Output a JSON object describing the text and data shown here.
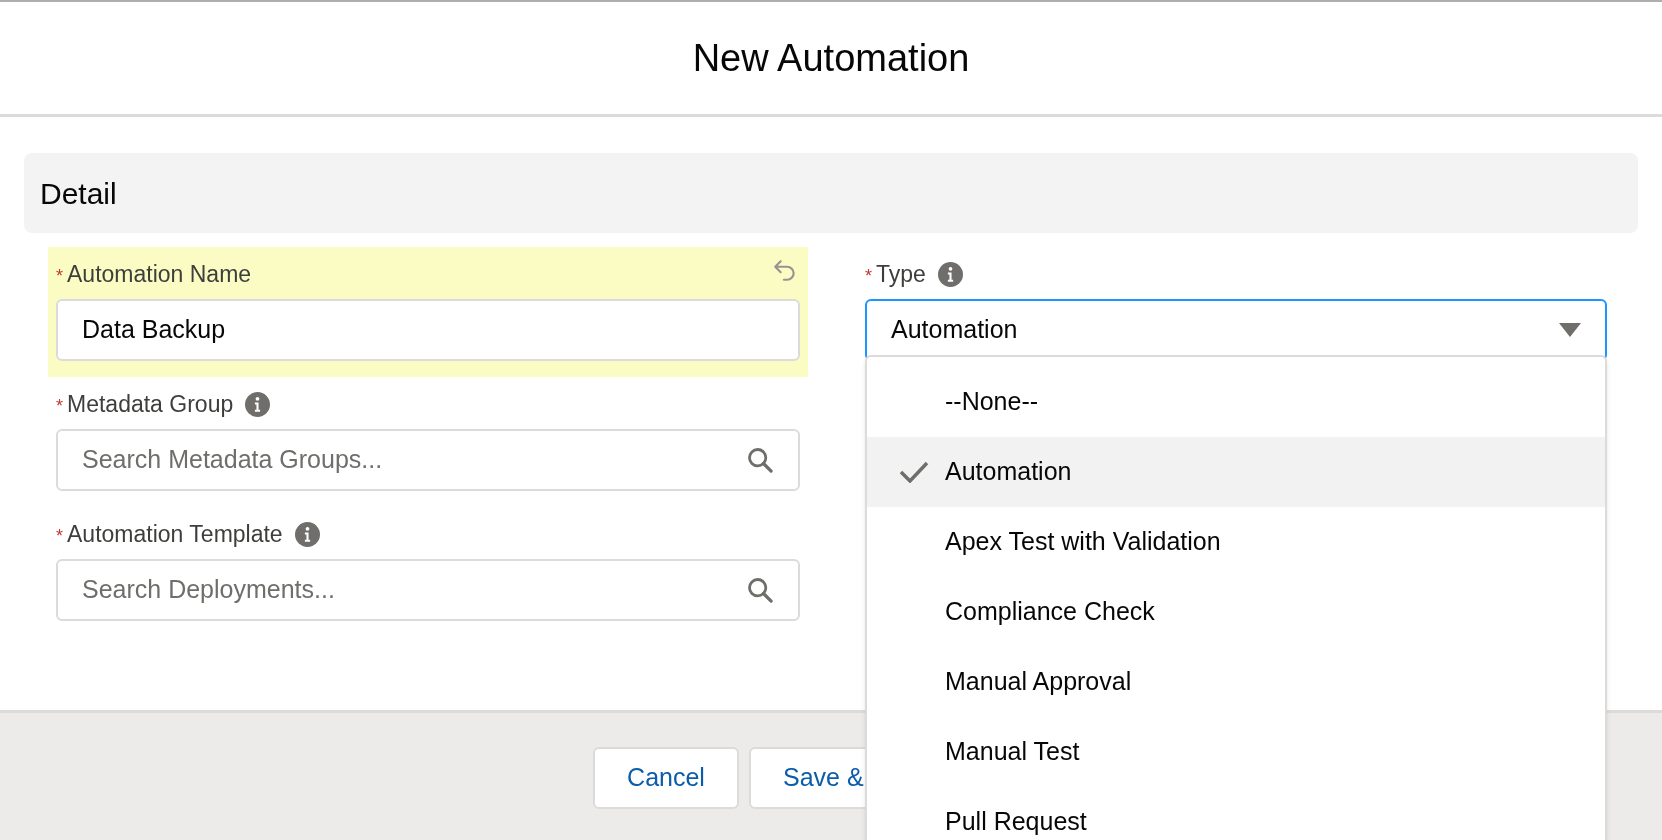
{
  "dialog": {
    "title": "New Automation"
  },
  "section": {
    "title": "Detail"
  },
  "left_fields": [
    {
      "kind": "text",
      "label": "Automation Name",
      "required_mark": "*",
      "info": false,
      "highlighted": true,
      "undo": true,
      "value": "Data Backup"
    },
    {
      "kind": "lookup",
      "label": "Metadata Group",
      "required_mark": "*",
      "info": true,
      "highlighted": false,
      "undo": false,
      "placeholder": "Search Metadata Groups..."
    },
    {
      "kind": "lookup",
      "label": "Automation Template",
      "required_mark": "*",
      "info": true,
      "highlighted": false,
      "undo": false,
      "placeholder": "Search Deployments..."
    }
  ],
  "type_field": {
    "label": "Type",
    "required_mark": "*",
    "info": true,
    "value": "Automation",
    "expanded": true,
    "options": [
      {
        "label": "--None--",
        "selected": false
      },
      {
        "label": "Automation",
        "selected": true
      },
      {
        "label": "Apex Test with Validation",
        "selected": false
      },
      {
        "label": "Compliance Check",
        "selected": false
      },
      {
        "label": "Manual Approval",
        "selected": false
      },
      {
        "label": "Manual Test",
        "selected": false
      },
      {
        "label": "Pull Request",
        "selected": false
      }
    ]
  },
  "footer": {
    "buttons": [
      "Cancel",
      "Save &"
    ]
  }
}
